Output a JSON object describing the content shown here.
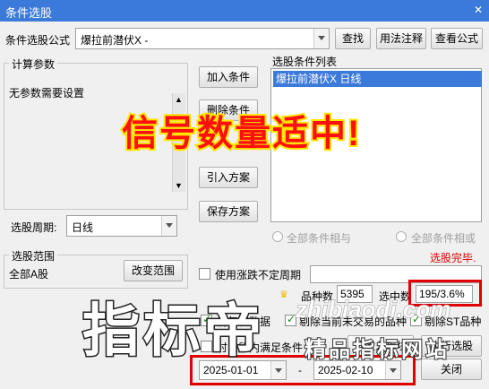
{
  "window": {
    "title": "条件选股",
    "close": "✕"
  },
  "formula": {
    "label": "条件选股公式",
    "value": "爆拉前潜伏X  -",
    "btn_find": "查找",
    "btn_usage": "用法注释",
    "btn_view": "查看公式"
  },
  "params": {
    "title": "计算参数",
    "text": "无参数需要设置"
  },
  "actions": {
    "add": "加入条件",
    "delete": "删除条件",
    "import": "引入方案",
    "save": "保存方案"
  },
  "condlist": {
    "title": "选股条件列表",
    "items": [
      "爆拉前潜伏X  日线"
    ]
  },
  "radios": {
    "and_all": "全部条件相与",
    "or_all": "全部条件相或"
  },
  "status": {
    "done": "选股完毕."
  },
  "period": {
    "label": "选股周期:",
    "value": "日线"
  },
  "range": {
    "title": "选股范围",
    "value": "全部A股",
    "btn_change": "改变范围"
  },
  "options": {
    "use_vary": "使用涨跌不定周期",
    "prerights": "前复权数据",
    "exclude_unlisted": "剔除当前未交易的品种",
    "exclude_st": "剔除ST品种",
    "time_range": "时间段内满足条件"
  },
  "stats": {
    "count_label": "品种数",
    "count": "5395",
    "hit_label": "选中数",
    "hit": "195/3.6%"
  },
  "dates": {
    "start": "2025-01-01",
    "sep": "-",
    "end": "2025-02-10"
  },
  "footer": {
    "btn_board": "选股入板块",
    "btn_run": "执行选股",
    "btn_close": "关闭"
  },
  "overlay": {
    "banner": "信号数量适中!",
    "watermark_big": "指标帝",
    "watermark_url": "zhibiaodi.com",
    "watermark_sub": "精品指标网站"
  },
  "colors": {
    "titlebar": "#3b7ad9",
    "banner_text": "#ff1010",
    "banner_bg": "#ffe600",
    "highlight": "#e00000",
    "list_selected": "#3b7ad9"
  }
}
